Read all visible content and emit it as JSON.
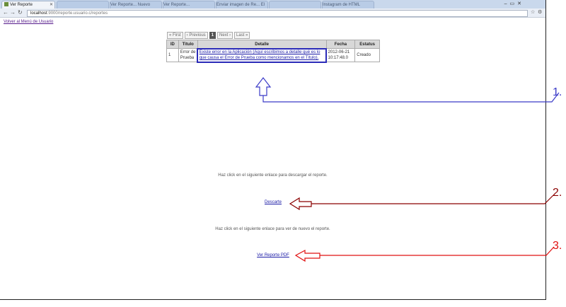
{
  "browser": {
    "active_tab_title": "Ver Reporte",
    "other_tabs": [
      "",
      "Ver Reporte... Nuevo",
      "Ver Reporte...",
      "Enviar imagen de Re... El",
      "",
      "Instagram de HTML"
    ],
    "url_host": "localhost",
    "url_path": ":9000/reporte.usuario.c/reportes"
  },
  "page": {
    "back_link": "Volver al Menú de Usuario",
    "pager": {
      "first": "« First",
      "previous": "‹ Previous",
      "current": "1",
      "next": "Next ›",
      "last": "Last »"
    },
    "table": {
      "headers": [
        "ID",
        "Titulo",
        "Detalle",
        "Fecha",
        "Estatus"
      ],
      "rows": [
        {
          "id": "1",
          "titulo": "Error de Prueba",
          "detalle": "Existe error en la Aplicación (Aquí escribimos a detalle qué es lo que causa el Error de Prueba como mencionamos en el Título).",
          "fecha": "2012-06-21 10:17:48.0",
          "estatus": "Creado"
        }
      ]
    },
    "download_text": "Haz click en el siguiente enlace para descargar el reporte.",
    "download_link": "Descarte",
    "view_text": "Haz click en el siguiente enlace para ver de nuevo el reporte.",
    "view_link": "Ver Reporte PDF"
  },
  "annotations": [
    {
      "label": "1.",
      "color": "#3b3bc8"
    },
    {
      "label": "2.",
      "color": "#8b0000"
    },
    {
      "label": "3.",
      "color": "#e01010"
    }
  ]
}
